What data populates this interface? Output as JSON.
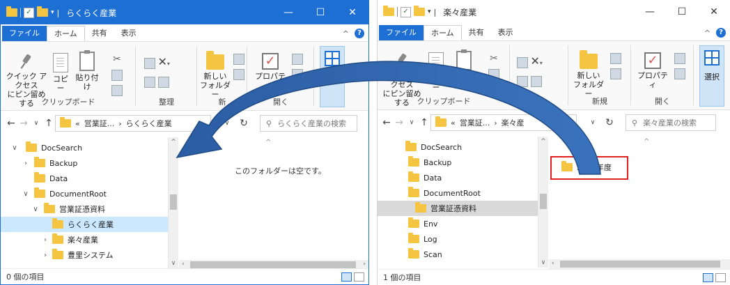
{
  "colors": {
    "accent": "#1e6fd3",
    "highlight_red": "#e01f1f",
    "folder": "#f5c542",
    "arrow": "#2e5fa0"
  },
  "left_window": {
    "title": "らくらく産業",
    "separator": "|",
    "controls": {
      "minimize": "—",
      "maximize": "☐",
      "close": "✕"
    },
    "tabs": {
      "file": "ファイル",
      "home": "ホーム",
      "share": "共有",
      "view": "表示"
    },
    "ribbon": {
      "pin_label_1": "クイック アクセス",
      "pin_label_2": "にピン留めする",
      "copy": "コピー",
      "paste": "貼り付け",
      "group_clipboard": "クリップボード",
      "group_organize": "整理",
      "group_new": "新",
      "new_folder_1": "新しい",
      "new_folder_2": "フォルダー",
      "properties": "プロパティ",
      "group_open": "開く",
      "select": "選択"
    },
    "address": {
      "chevrons": "«",
      "crumb1": "営業証...",
      "sep": "›",
      "crumb2": "らくらく産業",
      "search_placeholder": "らくらく産業の検索"
    },
    "tree": [
      {
        "label": "DocSearch",
        "chev": "∨"
      },
      {
        "label": "Backup",
        "chev": "›"
      },
      {
        "label": "Data",
        "chev": ""
      },
      {
        "label": "DocumentRoot",
        "chev": "∨"
      },
      {
        "label": "営業証憑資料",
        "chev": "∨"
      },
      {
        "label": "らくらく産業",
        "chev": ""
      },
      {
        "label": "楽々産業",
        "chev": "›"
      },
      {
        "label": "豊里システム",
        "chev": "›"
      }
    ],
    "empty_message": "このフォルダーは空です。",
    "status": "0 個の項目"
  },
  "right_window": {
    "title": "楽々産業",
    "separator": "|",
    "controls": {
      "minimize": "—",
      "maximize": "☐",
      "close": "✕"
    },
    "tabs": {
      "file": "ファイル",
      "home": "ホーム",
      "share": "共有",
      "view": "表示"
    },
    "ribbon": {
      "pin_label_1": "クイック アクセス",
      "pin_label_2": "にピン留めする",
      "copy": "コピー",
      "group_clipboard": "クリップボード",
      "new_folder_1": "新しい",
      "new_folder_2": "フォルダー",
      "group_new": "新規",
      "properties": "プロパティ",
      "group_open": "開く",
      "select": "選択"
    },
    "address": {
      "chevrons": "«",
      "crumb1": "営業証...",
      "sep": "›",
      "crumb2": "楽々産",
      "search_placeholder": "楽々産業の検索"
    },
    "tree": [
      {
        "label": "DocSearch"
      },
      {
        "label": "Backup"
      },
      {
        "label": "Data"
      },
      {
        "label": "DocumentRoot"
      },
      {
        "label": "営業証憑資料"
      },
      {
        "label": "Env"
      },
      {
        "label": "Log"
      },
      {
        "label": "Scan"
      }
    ],
    "file_item": "2022年度",
    "status": "1 個の項目"
  }
}
